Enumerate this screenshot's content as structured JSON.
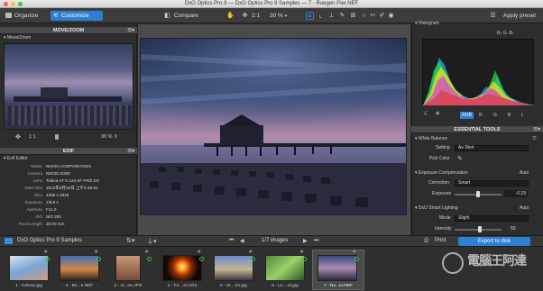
{
  "window": {
    "title": "DxO Optics Pro 9 — DxO Optics Pro 9 Samples — 7 - Ruegen Pier.NEF"
  },
  "toolbar": {
    "organize": "Organize",
    "customize": "Customize",
    "compare": "Compare",
    "ratio": "1:1",
    "zoom": "30 %",
    "apply_preset": "Apply preset"
  },
  "move_zoom": {
    "title": "MOVE/ZOOM",
    "sub": "Move/Zoom",
    "ratio": "1:1",
    "zoom": "30 %"
  },
  "exif": {
    "title": "EXIF",
    "sub": "Exif Editor",
    "rows": [
      {
        "key": "Maker",
        "value": "NIKON CORPORATION"
      },
      {
        "key": "Camera",
        "value": "NIKON D300"
      },
      {
        "key": "Lens",
        "value": "Tokina AT-X 124 AF PRO DX"
      },
      {
        "key": "Date shot",
        "value": "2012年8月15日 上午5:45:52"
      },
      {
        "key": "Size",
        "value": "4288 x 2848"
      },
      {
        "key": "Exposure",
        "value": "1/8.8 s"
      },
      {
        "key": "Aperture",
        "value": "F11.0"
      },
      {
        "key": "ISO",
        "value": "ISO 200"
      },
      {
        "key": "Focal Length",
        "value": "20.00 mm"
      }
    ]
  },
  "histogram": {
    "title": "Histogram",
    "mode": "R- G- B-",
    "channels": [
      "RGB",
      "R",
      "G",
      "B",
      "L"
    ]
  },
  "essential_tools": {
    "title": "ESSENTIAL TOOLS",
    "white_balance": {
      "label": "White Balance",
      "setting_label": "Setting",
      "setting_value": "As Shot",
      "pick_color": "Pick Color"
    },
    "exposure": {
      "label": "Exposure Compensation",
      "mode": "Auto",
      "correction_label": "Correction",
      "correction_value": "Smart",
      "exposure_label": "Exposure",
      "exposure_value": "-0.29"
    },
    "smart_lighting": {
      "label": "DxO Smart Lighting",
      "mode": "Auto",
      "mode_label": "Mode",
      "mode_value": "Slight",
      "intensity_label": "Intensity",
      "intensity_value": "50"
    }
  },
  "filmstrip": {
    "folder": "DxO Optics Pro 9 Samples",
    "counter": "1/7 images",
    "print": "Print",
    "export": "Export to disk",
    "items": [
      {
        "label": "1 - Helene.jpg"
      },
      {
        "label": "2 - Bo...e.NEF"
      },
      {
        "label": "3 - Vi...ne.JPG"
      },
      {
        "label": "4 - Fir....er.CR2"
      },
      {
        "label": "5 - St....tm.jpg"
      },
      {
        "label": "6 - Lo....rd.jpg"
      },
      {
        "label": "7 - Ru...er.NEF"
      }
    ]
  },
  "watermark": {
    "text": "電腦王阿達"
  },
  "colors": {
    "accent": "#2e7fd1",
    "panel_bg": "#2b2b2b",
    "title_bg": "#4a4a4a"
  }
}
